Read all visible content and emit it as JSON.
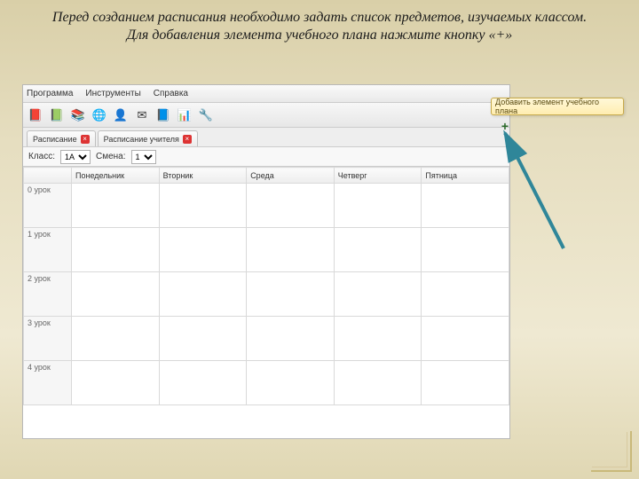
{
  "caption": "Перед созданием расписания необходимо задать список предметов, изучаемых классом. Для добавления элемента учебного плана нажмите кнопку «+»",
  "menubar": {
    "items": [
      "Программа",
      "Инструменты",
      "Справка"
    ]
  },
  "toolbar_icons": [
    {
      "name": "book-red-icon",
      "bg": "#c23",
      "glyph": "📕"
    },
    {
      "name": "book-green-icon",
      "bg": "#3a8",
      "glyph": "📗"
    },
    {
      "name": "books-icon",
      "bg": "#679",
      "glyph": "📚"
    },
    {
      "name": "globe-icon",
      "bg": "#3a7bd5",
      "glyph": "🌐"
    },
    {
      "name": "teacher-icon",
      "bg": "#b58a4a",
      "glyph": "👤"
    },
    {
      "name": "mail-icon",
      "bg": "#e8c34a",
      "glyph": "✉"
    },
    {
      "name": "notebook-icon",
      "bg": "#4a6fb5",
      "glyph": "📘"
    },
    {
      "name": "chart-icon",
      "bg": "#6aa",
      "glyph": "📊"
    },
    {
      "name": "tools-icon",
      "bg": "#999",
      "glyph": "🔧"
    }
  ],
  "tabs": [
    {
      "label": "Расписание",
      "has_close": true
    },
    {
      "label": "Расписание учителя",
      "has_close": true
    }
  ],
  "filters": {
    "class_label": "Класс:",
    "class_value": "1А",
    "shift_label": "Смена:",
    "shift_value": "1"
  },
  "grid": {
    "cols": [
      "",
      "Понедельник",
      "Вторник",
      "Среда",
      "Четверг",
      "Пятница"
    ],
    "rows": [
      "0 урок",
      "1 урок",
      "2 урок",
      "3 урок",
      "4 урок"
    ]
  },
  "tooltip": "Добавить элемент учебного плана",
  "plus_glyph": "+"
}
